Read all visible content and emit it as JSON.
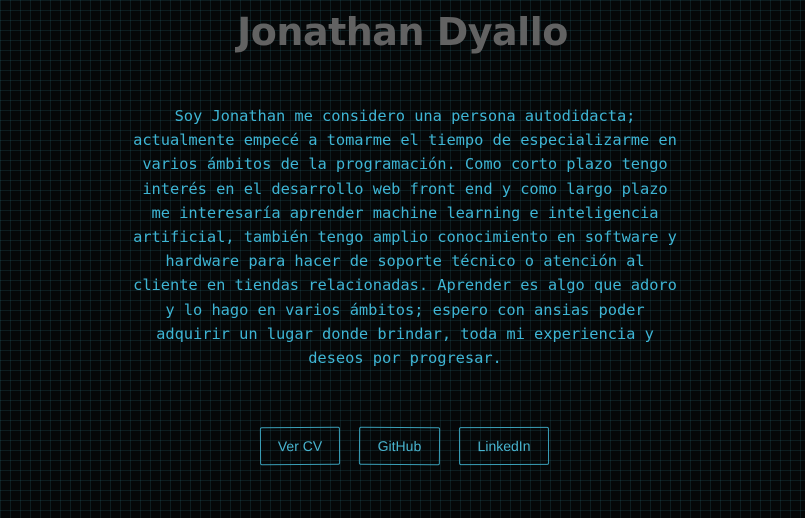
{
  "header": {
    "name": "Jonathan Dyallo"
  },
  "about": {
    "lines": [
      "Soy Jonathan me considero una persona autodidacta;",
      "actualmente empecé a tomarme el tiempo de especializarme en",
      "varios ámbitos de la programación. Como corto plazo tengo",
      "interés en el desarrollo web front end y como largo plazo",
      "me interesaría aprender machine learning e inteligencia",
      "artificial, también tengo amplio conocimiento en software y",
      "hardware para hacer de soporte técnico o atención al",
      "cliente en tiendas relacionadas. Aprender es algo que adoro",
      "y lo hago en varios ámbitos; espero con ansias poder",
      "adquirir un lugar donde brindar, toda mi experiencia y",
      "deseos por progresar."
    ]
  },
  "links": {
    "cv_label": "Ver CV",
    "github_label": "GitHub",
    "linkedin_label": "LinkedIn"
  },
  "colors": {
    "background": "#050708",
    "grid": "#286e78",
    "title": "#626262",
    "text": "#3eb5d4",
    "button_border": "#3a9fb8"
  }
}
